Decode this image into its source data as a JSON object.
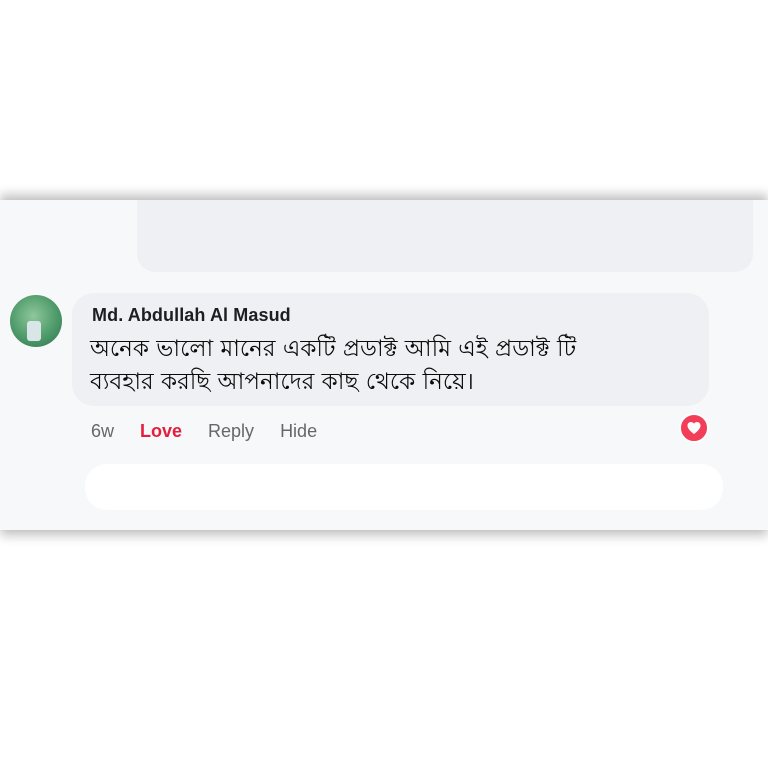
{
  "comment": {
    "author": "Md. Abdullah Al Masud",
    "text_line_1": "অনেক ভালো মানের একটি প্রডাক্ট আমি এই প্রডাক্ট টি",
    "text_line_2": "ব্যবহার করছি আপনাদের কাছ থেকে নিয়ে।",
    "time": "6w",
    "love_label": "Love",
    "reply_label": "Reply",
    "hide_label": "Hide",
    "reaction": "heart-reaction-icon"
  },
  "colors": {
    "love": "#e41e3f",
    "reaction_bg": "#f33e58",
    "bubble_bg": "#eef0f3",
    "muted_text": "#65676b"
  }
}
